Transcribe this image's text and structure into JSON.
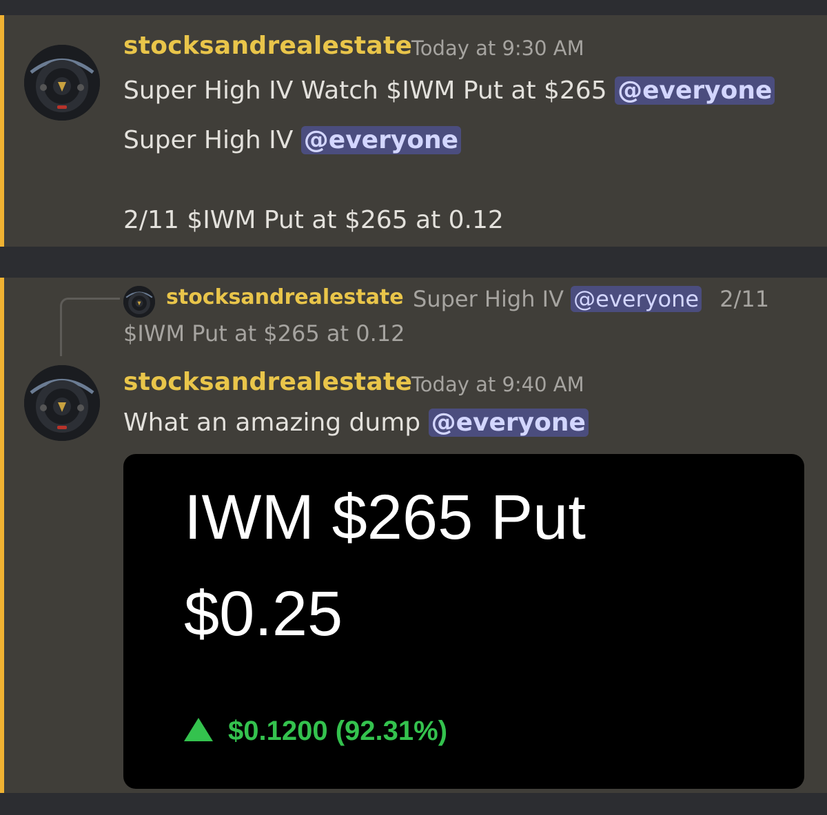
{
  "messages": [
    {
      "username": "stocksandrealestate",
      "timestamp": "Today at 9:30 AM",
      "line1_text": "Super High IV Watch $IWM Put at $265",
      "line1_mention": "@everyone",
      "line2_text": "Super High IV",
      "line2_mention": "@everyone",
      "line3_text": "2/11 $IWM Put at $265 at 0.12"
    },
    {
      "reply": {
        "username": "stocksandrealestate",
        "text_before": "Super High IV",
        "mention": "@everyone",
        "text_after": "2/11",
        "text_line2": "$IWM Put at $265 at 0.12"
      },
      "username": "stocksandrealestate",
      "timestamp": "Today at 9:40 AM",
      "text": "What an amazing dump",
      "mention": "@everyone",
      "card": {
        "title": "IWM $265 Put",
        "price": "$0.25",
        "change": "$0.1200 (92.31%)",
        "change_direction": "up",
        "change_color": "#34c24e"
      }
    }
  ],
  "colors": {
    "username": "#e9c54a",
    "accent_bar": "#f0b232",
    "mention_bg": "#4b4d7e",
    "message_bg": "#403e39"
  },
  "icons": {
    "avatar": "steering-wheel-avatar-icon",
    "change_arrow": "triangle-up-icon"
  }
}
